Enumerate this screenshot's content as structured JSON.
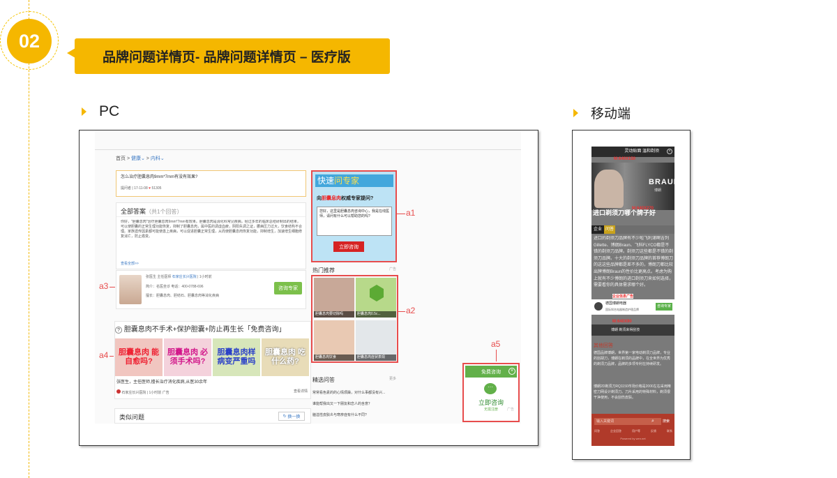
{
  "section_number": "02",
  "title": "品牌问题详情页- 品牌问题详情页 – 医疗版",
  "pc_label": "PC",
  "mobile_label": "移动端",
  "pc": {
    "breadcrumb": [
      "首页",
      "健康",
      "内科"
    ],
    "question": {
      "text": "怎么治疗胆囊息肉9mm*7mm有没有效果?",
      "user": "提问者",
      "date": "17-11-08",
      "likes": "51305"
    },
    "answers": {
      "title": "全部答案",
      "count": "（共1个回答）",
      "body": "你好，\"胆囊息肉\"治疗胆囊息肉9mm*7mm有效果。胆囊息肉是消化科常见疾病，经过多年的临床总结研制出的结果，可以使胆囊的正常生理功能恢复，抑制了胆囊息肉，属中医的调虚血疲，阴阳失调之证，腰病压力过大，饮食结构不合理。家族遗传因素都可能使患上疾病，可以促进胆囊正常生理，从而使胆囊息肉恢复功能，抑制增生，加速增生细胞修复消亡，防止癌变。",
      "more": "查看全部>>"
    },
    "doctor": {
      "name": "张医生 主任医师",
      "hospital": "石家庄长兴医院",
      "time": "1小时前",
      "intro": "简介：名医坐诊 电话：400-0788-696",
      "expertise": "擅长：胆囊息肉、胆结石、胆囊息肉等消化疾病",
      "button": "咨询专家"
    },
    "ad": {
      "title": "胆囊息肉不手术+保护胆囊+防止再生长「免费咨询」",
      "images": [
        "胆囊息肉 能自愈吗?",
        "胆囊息肉 必须手术吗?",
        "胆囊息肉样 病变严重吗",
        "胆囊息肉 吃什么药?"
      ],
      "desc": "张医生，主任医师,擅长治疗消化疾病,从医30余年",
      "source": "石家庄长兴医院",
      "time": "1小时前",
      "tag": "广告",
      "detail": "查看详情"
    },
    "similar": {
      "title": "类似问题",
      "refresh": "换一换"
    },
    "expert": {
      "head_prefix": "快速",
      "head_highlight": "问专家",
      "question_prefix": "向",
      "question_highlight": "胆囊息肉",
      "question_suffix": "权威专家提问?",
      "placeholder": "您好，这里是胆囊息肉咨询中心，我是在线医师，请问有什么可以帮助您的吗?",
      "button": "立即咨询"
    },
    "hot": {
      "title": "热门推荐",
      "tag": "广告",
      "items": [
        "胆囊息肉要切除吗",
        "胆囊息肉0.5c...",
        "胆囊息肉饮食",
        "胆囊息肉症状表现"
      ]
    },
    "selected": {
      "title": "精选问答",
      "more": "更多",
      "items": [
        "常常看色素的的心情烦躁，对什么事都没有兴...",
        "谁能帮我出又一下朋友和恋人的含意？",
        "脑溢性皮肤炎与寒疹症有什么不同?"
      ]
    },
    "float": {
      "title": "免费咨询",
      "action": "立即咨询",
      "sub": "无需注册",
      "tag": "广告"
    },
    "labels": [
      "a1",
      "a2",
      "a3",
      "a4",
      "a5"
    ]
  },
  "mobile": {
    "top_banner": "灵动贴面 温和剃须",
    "size_tag1": "M:640X150",
    "brand": "BRAUN",
    "brand_sub": "博朗",
    "headline": "进口剃须刀哪个牌子好",
    "size_tag2": "M:640X270",
    "tabs": [
      "企业",
      "问答"
    ],
    "body": "进口的剃须刀品牌有不少啦飞利浦啊吉列Gillette、博朗Braun、飞科FLYCO都是不错的剃须刀品牌。剃须刀这些都是不错的剃须刀品牌。十大的剃须刀品牌的首荐博朗刀的这这些品牌都是差不多的，博朗刀都比较出牌博朗Braun的性价比更高点。考虑为购上就有不少博朗的进口剃须刀来如何选择，需要看你的具体需求哪个好。",
    "company_tag": "企业信息广告",
    "company_name": "德国博朗电器",
    "company_desc": "国际知名电器制造护理品牌",
    "company_button": "咨询专家",
    "size_tag3": "M:640X90",
    "promo_text": "博朗 剃须来得刮技",
    "other_title": "其他回答",
    "other_answers": [
      "德国品牌博朗，世界第一家电动剃须刀品牌，专业的刮胡刀，博朗在剃须的品牌中，在全世界为优秀的剃须刀品牌，品牌的多项专利在持续研发。",
      "博朗2D剃须刀RQ1150市场价格是2000左右采用精密刀网设计剃须刀。刀片采用的特殊材料，剃须很干净使用，不会刮伤皮肤。"
    ],
    "search_placeholder": "输入关键词",
    "search_button": "搜索",
    "footer_links": [
      "问答",
      "企业回答",
      "用户等",
      "反馈",
      "联系"
    ],
    "footer_copy": "Powered by wen.net"
  }
}
